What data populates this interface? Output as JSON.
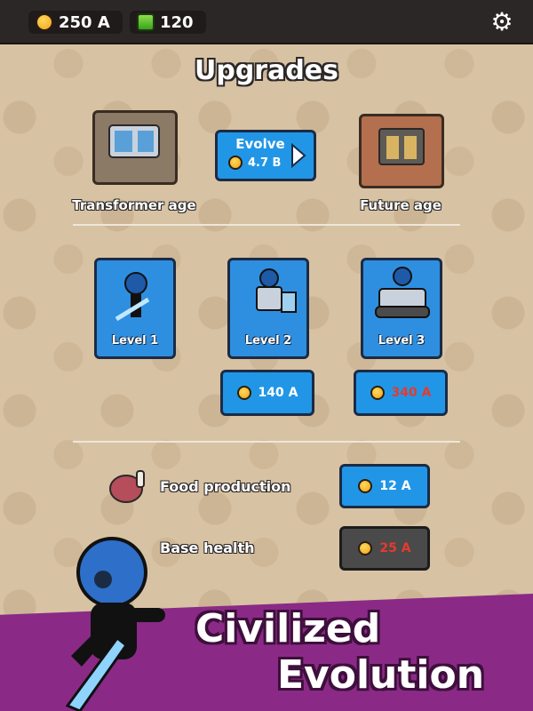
{
  "topbar": {
    "coins": "250 A",
    "gems": "120",
    "settings_icon": "gear-icon"
  },
  "title": "Upgrades",
  "evolution": {
    "current_age": "Transformer age",
    "next_age": "Future age",
    "evolve_label": "Evolve",
    "evolve_cost": "4.7 B"
  },
  "levels": [
    {
      "label": "Level 1",
      "cost": null
    },
    {
      "label": "Level 2",
      "cost": "140 A"
    },
    {
      "label": "Level 3",
      "cost": "340 A"
    }
  ],
  "upgrades": [
    {
      "label": "Food production",
      "cost": "12 A",
      "icon": "meat-icon"
    },
    {
      "label": "Base health",
      "cost": "25 A"
    }
  ],
  "promo": {
    "line1": "Civilized",
    "line2": "Evolution"
  },
  "colors": {
    "background": "#d7c2a3",
    "topbar": "#2c2727",
    "button_blue": "#2296e6",
    "button_gray": "#4a4a4a",
    "unaffordable_price": "#e63a2e",
    "promo": "#8a2a86"
  }
}
